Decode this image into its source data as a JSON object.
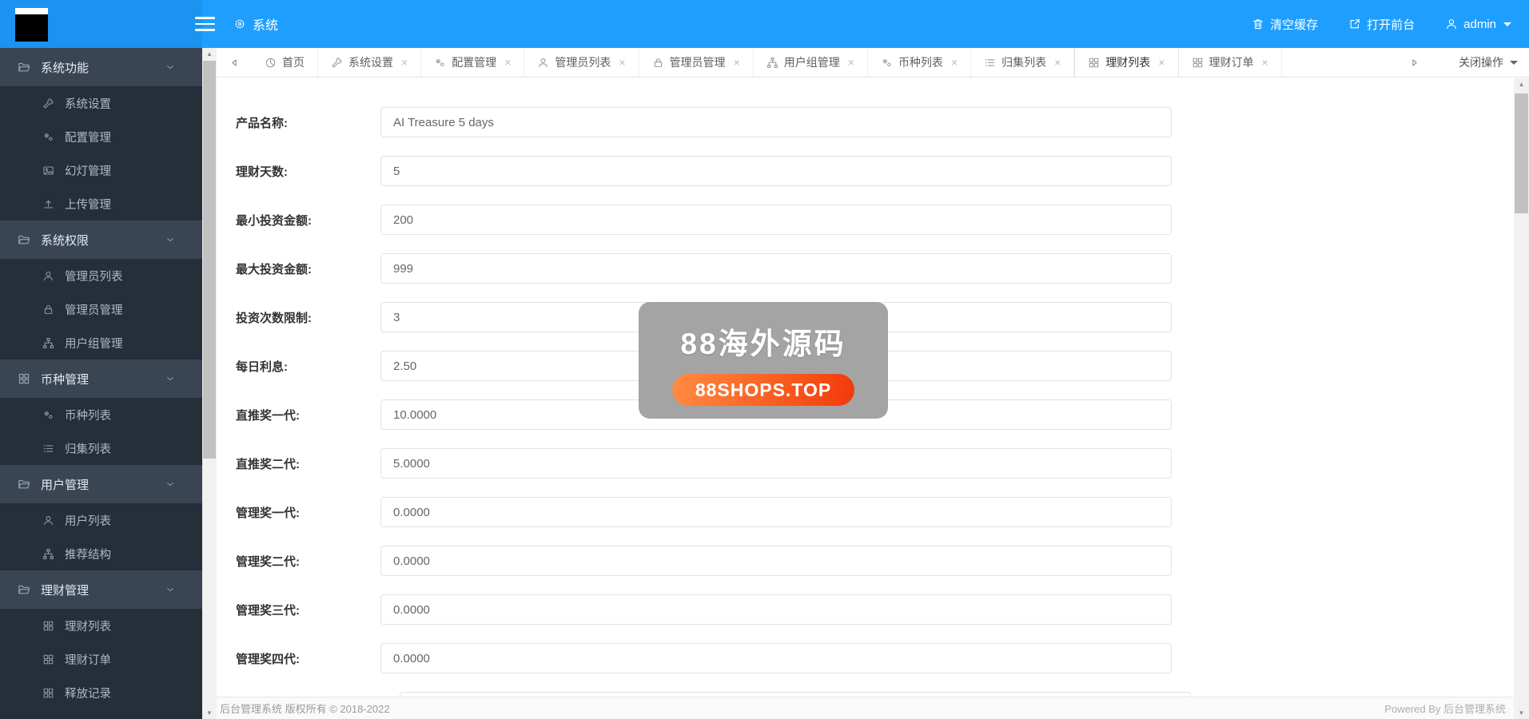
{
  "ui": {
    "close_glyph": "×",
    "up_arrow": "▲",
    "down_arrow": "▼"
  },
  "colors": {
    "header_blue": "#1E9FFF",
    "sidebar_dark": "#252E39",
    "sidebar_group": "#3A4554",
    "badge_orange": "#F23A0A"
  },
  "header": {
    "title": "系统",
    "title_icon": "gear",
    "actions": [
      {
        "label": "清空缓存",
        "icon": "trash"
      },
      {
        "label": "打开前台",
        "icon": "external"
      },
      {
        "label": "admin",
        "icon": "user"
      }
    ]
  },
  "sidebar": {
    "groups": [
      {
        "label": "系统功能",
        "icon": "folder",
        "items": [
          {
            "label": "系统设置",
            "icon": "wrench"
          },
          {
            "label": "配置管理",
            "icon": "cogs"
          },
          {
            "label": "幻灯管理",
            "icon": "image"
          },
          {
            "label": "上传管理",
            "icon": "upload"
          }
        ]
      },
      {
        "label": "系统权限",
        "icon": "folder",
        "items": [
          {
            "label": "管理员列表",
            "icon": "user"
          },
          {
            "label": "管理员管理",
            "icon": "lock"
          },
          {
            "label": "用户组管理",
            "icon": "sitemap"
          }
        ]
      },
      {
        "label": "币种管理",
        "icon": "grid",
        "items": [
          {
            "label": "币种列表",
            "icon": "cogs"
          },
          {
            "label": "归集列表",
            "icon": "list"
          }
        ]
      },
      {
        "label": "用户管理",
        "icon": "folder",
        "items": [
          {
            "label": "用户列表",
            "icon": "user"
          },
          {
            "label": "推荐结构",
            "icon": "sitemap"
          }
        ]
      },
      {
        "label": "理财管理",
        "icon": "folder",
        "items": [
          {
            "label": "理财列表",
            "icon": "grid"
          },
          {
            "label": "理财订单",
            "icon": "grid"
          },
          {
            "label": "释放记录",
            "icon": "grid"
          }
        ]
      }
    ]
  },
  "tabbar": {
    "close_action": "关闭操作",
    "tabs": [
      {
        "label": "首页",
        "icon": "home",
        "closable": false,
        "active": false
      },
      {
        "label": "系统设置",
        "icon": "wrench",
        "closable": true,
        "active": false
      },
      {
        "label": "配置管理",
        "icon": "cogs",
        "closable": true,
        "active": false
      },
      {
        "label": "管理员列表",
        "icon": "user",
        "closable": true,
        "active": false
      },
      {
        "label": "管理员管理",
        "icon": "lock",
        "closable": true,
        "active": false
      },
      {
        "label": "用户组管理",
        "icon": "sitemap",
        "closable": true,
        "active": false
      },
      {
        "label": "币种列表",
        "icon": "cogs",
        "closable": true,
        "active": false
      },
      {
        "label": "归集列表",
        "icon": "list",
        "closable": true,
        "active": false
      },
      {
        "label": "理财列表",
        "icon": "grid",
        "closable": true,
        "active": true
      },
      {
        "label": "理财订单",
        "icon": "grid",
        "closable": true,
        "active": false
      }
    ]
  },
  "form": {
    "fields": [
      {
        "label": "产品名称:",
        "value": "AI Treasure 5 days"
      },
      {
        "label": "理财天数:",
        "value": "5"
      },
      {
        "label": "最小投资金额:",
        "value": "200"
      },
      {
        "label": "最大投资金额:",
        "value": "999"
      },
      {
        "label": "投资次数限制:",
        "value": "3"
      },
      {
        "label": "每日利息:",
        "value": "2.50"
      },
      {
        "label": "直推奖一代:",
        "value": "10.0000"
      },
      {
        "label": "直推奖二代:",
        "value": "5.0000"
      },
      {
        "label": "管理奖一代:",
        "value": "0.0000"
      },
      {
        "label": "管理奖二代:",
        "value": "0.0000"
      },
      {
        "label": "管理奖三代:",
        "value": "0.0000"
      },
      {
        "label": "管理奖四代:",
        "value": "0.0000"
      }
    ]
  },
  "watermark": {
    "title": "88海外源码",
    "badge": "88SHOPS.TOP"
  },
  "footer": {
    "copyright": "后台管理系统 版权所有 © 2018-2022",
    "powered": "Powered By 后台管理系统"
  }
}
